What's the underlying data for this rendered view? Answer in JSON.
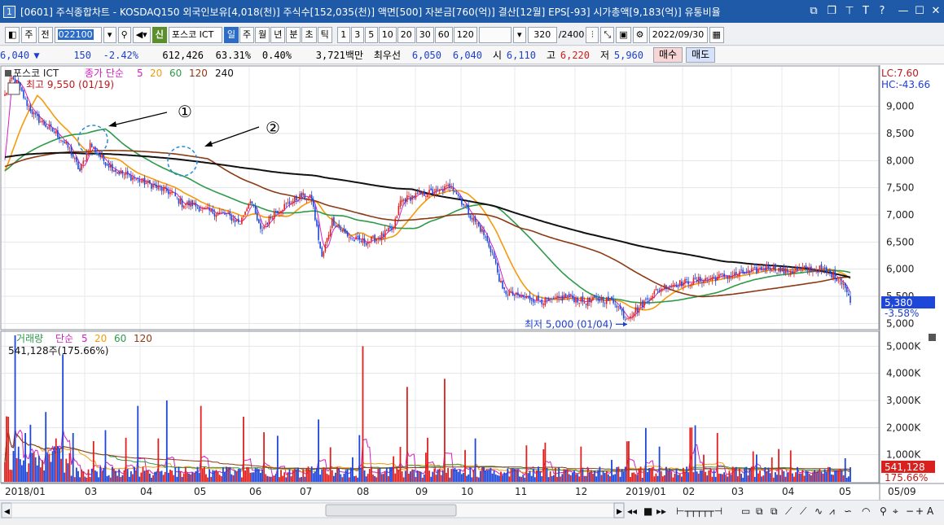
{
  "window": {
    "number": "1",
    "title": "[0601] 주식종합차트 - KOSDAQ150 외국인보유[4,018(천)] 주식수[152,035(천)] 액면[500] 자본금[760(억)] 결산[12월] EPS[-93] 시가총액[9,183(억)] 유통비율"
  },
  "toolbar": {
    "period_prefix": "주",
    "prev_label": "전",
    "code": "022100",
    "sin_label": "신",
    "stock_name": "포스코 ICT",
    "periods": [
      "일",
      "주",
      "월",
      "년",
      "분",
      "초",
      "틱"
    ],
    "selected_period": "일",
    "minutes": [
      "1",
      "3",
      "5",
      "10",
      "20",
      "30",
      "60",
      "120"
    ],
    "count": "320",
    "count_total": "/2400",
    "date": "2022/09/30"
  },
  "quote": {
    "price": "6,040",
    "arrow": "▼",
    "change": "150",
    "change_pct": "-2.42%",
    "volume": "612,426",
    "volume_ratio": "63.31%",
    "turnover": "0.40%",
    "amount": "3,721백만",
    "best_ask_label": "최우선",
    "best_ask": "6,050",
    "best_bid": "6,040",
    "open_label": "시",
    "open": "6,110",
    "high_label": "고",
    "high": "6,220",
    "low_label": "저",
    "low": "5,960",
    "buy_label": "매수",
    "sell_label": "매도"
  },
  "price_panel": {
    "stock_label": "포스코 ICT",
    "ma_label": "종가 단순",
    "ma_periods": [
      "5",
      "20",
      "60",
      "120",
      "240"
    ],
    "max_note": "최고 9,550 (01/19)",
    "min_note": "최저 5,000 (01/04)",
    "lc": "LC:7.60",
    "hc": "HC:-43.66",
    "last_price": "5,380",
    "last_change": "-3.58%",
    "annotation_1": "①",
    "annotation_2": "②"
  },
  "volume_panel": {
    "label": "거래량",
    "ma_label": "단순",
    "ma_periods": [
      "5",
      "20",
      "60",
      "120"
    ],
    "current": "541,128주(175.66%)",
    "last_volume": "541,128",
    "last_ratio": "175.66%"
  },
  "colors": {
    "up": "#e0201e",
    "down": "#1e46d8",
    "ma5": "#d41fc2",
    "ma20": "#f59a0c",
    "ma60": "#2e9a4a",
    "ma120": "#8b3a14",
    "ma240": "#111111"
  },
  "chart_data": {
    "type": "candlestick",
    "x_axis_labels": [
      "2018/01",
      "03",
      "04",
      "05",
      "06",
      "07",
      "08",
      "09",
      "10",
      "11",
      "12",
      "2019/01",
      "02",
      "03",
      "04",
      "05",
      "05/09"
    ],
    "price_ylim": [
      4900,
      9700
    ],
    "price_ticks": [
      "5,000",
      "5,500",
      "6,000",
      "6,500",
      "7,000",
      "7,500",
      "8,000",
      "8,500",
      "9,000"
    ],
    "volume_ylim": [
      0,
      5400000
    ],
    "volume_ticks": [
      "1,000K",
      "2,000K",
      "3,000K",
      "4,000K",
      "5,000K"
    ],
    "close_anchors": [
      [
        0,
        9200
      ],
      [
        4,
        9500
      ],
      [
        8,
        9400
      ],
      [
        12,
        9100
      ],
      [
        18,
        8800
      ],
      [
        26,
        8600
      ],
      [
        32,
        8450
      ],
      [
        38,
        8200
      ],
      [
        44,
        7800
      ],
      [
        50,
        8300
      ],
      [
        58,
        8000
      ],
      [
        66,
        7800
      ],
      [
        74,
        7700
      ],
      [
        82,
        7600
      ],
      [
        90,
        7500
      ],
      [
        98,
        7400
      ],
      [
        104,
        7200
      ],
      [
        110,
        7200
      ],
      [
        116,
        7100
      ],
      [
        122,
        7050
      ],
      [
        130,
        7000
      ],
      [
        138,
        6850
      ],
      [
        144,
        7300
      ],
      [
        150,
        6700
      ],
      [
        158,
        7050
      ],
      [
        166,
        7200
      ],
      [
        174,
        7350
      ],
      [
        180,
        7300
      ],
      [
        186,
        6200
      ],
      [
        192,
        6900
      ],
      [
        198,
        6700
      ],
      [
        204,
        6550
      ],
      [
        212,
        6500
      ],
      [
        220,
        6600
      ],
      [
        228,
        6750
      ],
      [
        232,
        7250
      ],
      [
        240,
        7350
      ],
      [
        248,
        7400
      ],
      [
        256,
        7450
      ],
      [
        262,
        7550
      ],
      [
        268,
        7250
      ],
      [
        274,
        6950
      ],
      [
        280,
        6700
      ],
      [
        286,
        6300
      ],
      [
        292,
        5600
      ],
      [
        300,
        5500
      ],
      [
        310,
        5450
      ],
      [
        320,
        5400
      ],
      [
        330,
        5500
      ],
      [
        340,
        5400
      ],
      [
        350,
        5450
      ],
      [
        358,
        5400
      ],
      [
        364,
        5100
      ],
      [
        372,
        5300
      ],
      [
        380,
        5550
      ],
      [
        388,
        5700
      ],
      [
        398,
        5750
      ],
      [
        408,
        5800
      ],
      [
        418,
        5850
      ],
      [
        428,
        5900
      ],
      [
        438,
        5950
      ],
      [
        448,
        6050
      ],
      [
        458,
        5950
      ],
      [
        468,
        6000
      ],
      [
        478,
        6000
      ],
      [
        486,
        5900
      ],
      [
        492,
        5750
      ],
      [
        496,
        5380
      ]
    ]
  }
}
